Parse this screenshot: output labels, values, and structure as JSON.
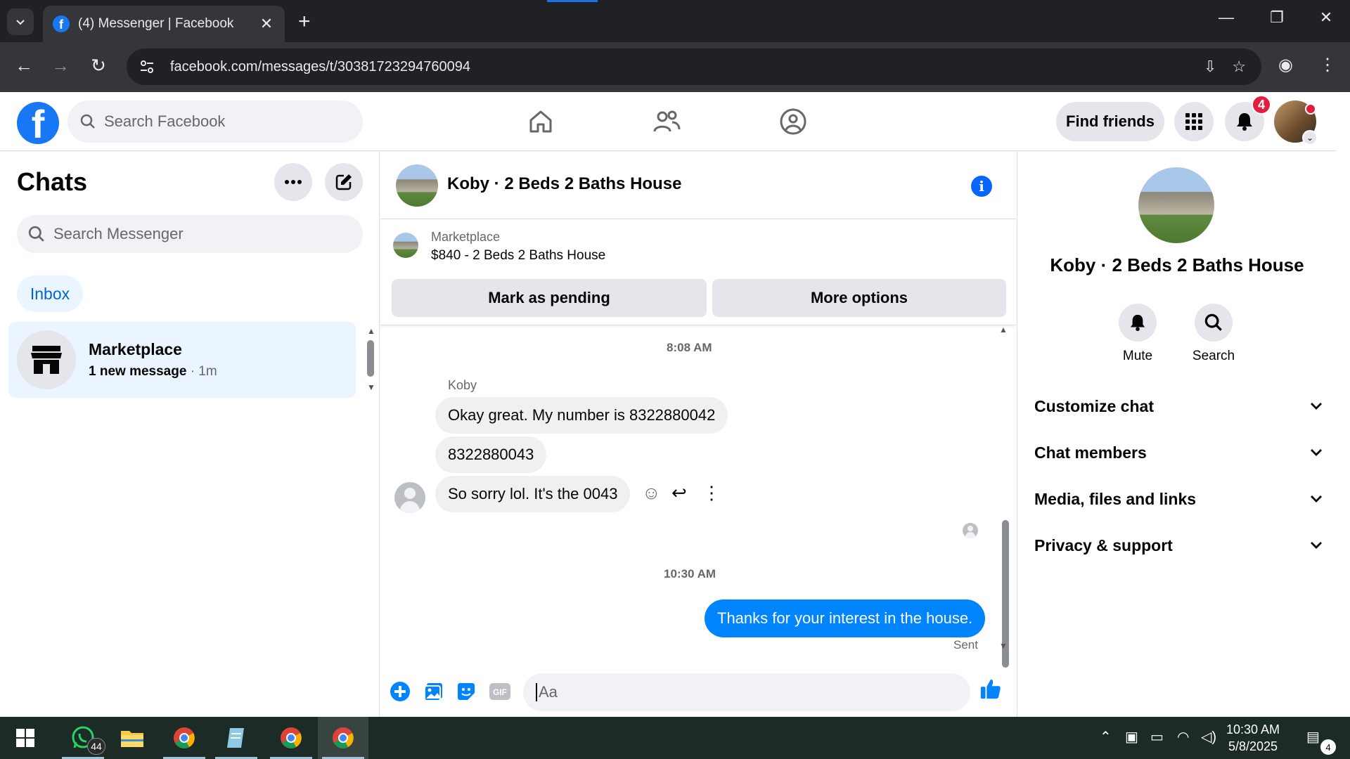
{
  "browser": {
    "tab_title": "(4) Messenger | Facebook",
    "url": "facebook.com/messages/t/30381723294760094",
    "tab_close": "✕",
    "new_tab": "+"
  },
  "fb_header": {
    "logo_letter": "f",
    "search_placeholder": "Search Facebook",
    "find_friends": "Find friends",
    "notification_count": "4"
  },
  "chats": {
    "title": "Chats",
    "search_placeholder": "Search Messenger",
    "filter_inbox": "Inbox",
    "items": [
      {
        "name": "Marketplace",
        "preview": "1 new message",
        "time": " · 1m"
      }
    ]
  },
  "conversation": {
    "title": "Koby · 2 Beds 2 Baths House",
    "marketplace_label": "Marketplace",
    "listing": "$840 - 2 Beds 2 Baths House",
    "mark_pending": "Mark as pending",
    "more_options": "More options",
    "timestamp_1": "8:08 AM",
    "sender": "Koby",
    "messages_in": [
      "Okay great. My number is 8322880042",
      "8322880043",
      "So sorry lol. It's the 0043"
    ],
    "timestamp_2": "10:30 AM",
    "message_out": "Thanks for your interest in the house.",
    "sent_status": "Sent",
    "composer_placeholder": "Aa"
  },
  "info_panel": {
    "name": "Koby · 2 Beds 2 Baths House",
    "mute": "Mute",
    "search": "Search",
    "sections": [
      "Customize chat",
      "Chat members",
      "Media, files and links",
      "Privacy & support"
    ]
  },
  "taskbar": {
    "whatsapp_badge": "44",
    "time": "10:30 AM",
    "date": "5/8/2025",
    "notif_count": "4"
  },
  "colors": {
    "fb_blue": "#1877f2",
    "messenger_blue": "#0084ff",
    "badge_red": "#e41e3f"
  }
}
